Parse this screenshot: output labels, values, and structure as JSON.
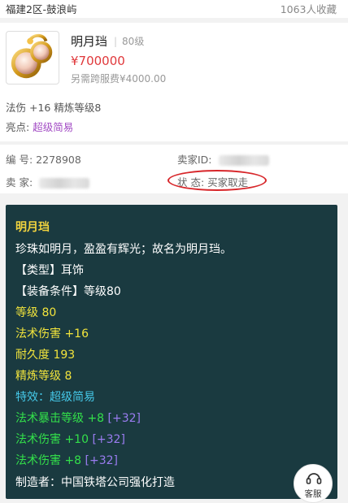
{
  "header": {
    "server": "福建2区-鼓浪屿",
    "favorites": "1063人收藏"
  },
  "item": {
    "name": "明月珰",
    "level": "80级",
    "price": "¥700000",
    "extra_fee": "另需跨服费¥4000.00",
    "attributes": "法伤 +16 精炼等级8",
    "highlight_label": "亮点:",
    "highlight_value": "超级简易"
  },
  "listing": {
    "id_label": "编  号:",
    "id_value": "2278908",
    "seller_id_label": "卖家ID:",
    "seller_label": "卖  家:",
    "status_label": "状  态:",
    "status_value": "买家取走"
  },
  "detail": {
    "title": "明月珰",
    "desc": "珍珠如明月，盈盈有辉光；故名为明月珰。",
    "type": "【类型】耳饰",
    "requirement": "【装备条件】等级80",
    "level": "等级 80",
    "magic_dmg": "法术伤害 +16",
    "durability": "耐久度 193",
    "refine": "精炼等级 8",
    "special": "特效：超级简易",
    "bonus1": "法术暴击等级 +8",
    "bonus1_extra": "[+32]",
    "bonus2": "法术伤害 +10",
    "bonus2_extra": "[+32]",
    "bonus3": "法术伤害 +8",
    "bonus3_extra": "[+32]",
    "maker": "制造者：中国铁塔公司强化打造"
  },
  "service": {
    "label": "客服"
  },
  "colors": {
    "price": "#e0383b",
    "highlight": "#a24bc4",
    "panel_bg": "#1a3a40",
    "status_ring": "#d7262a"
  }
}
